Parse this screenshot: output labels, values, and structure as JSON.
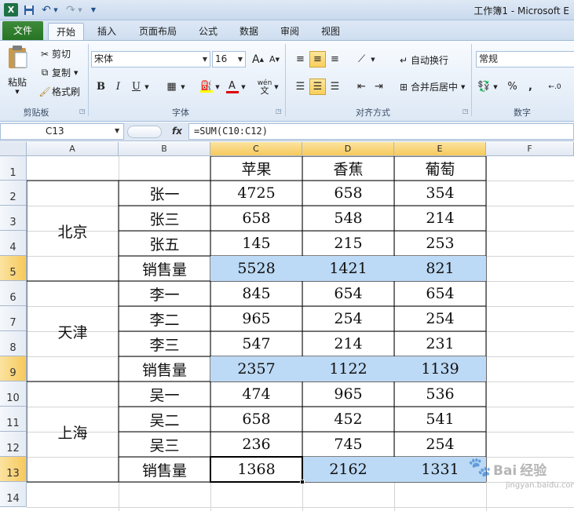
{
  "title_bar": {
    "title": "工作簿1 - Microsoft E"
  },
  "tabs": [
    {
      "label": "文件"
    },
    {
      "label": "开始"
    },
    {
      "label": "插入"
    },
    {
      "label": "页面布局"
    },
    {
      "label": "公式"
    },
    {
      "label": "数据"
    },
    {
      "label": "审阅"
    },
    {
      "label": "视图"
    }
  ],
  "ribbon": {
    "clipboard": {
      "paste": "粘贴",
      "cut": "剪切",
      "copy": "复制",
      "format_painter": "格式刷",
      "label": "剪贴板"
    },
    "font": {
      "name": "宋体",
      "size": "16",
      "label": "字体",
      "bold": "B",
      "italic": "I",
      "underline": "U",
      "grow": "A",
      "shrink": "A",
      "font_color": "A",
      "phonetic": "wén"
    },
    "alignment": {
      "wrap_text": "自动换行",
      "merge_center": "合并后居中",
      "label": "对齐方式"
    },
    "number": {
      "format": "常规",
      "percent": "%",
      "comma": ",",
      "label": "数字"
    }
  },
  "formula_bar": {
    "name_box": "C13",
    "fx": "fx",
    "formula": "=SUM(C10:C12)"
  },
  "sheet": {
    "columns": [
      "A",
      "B",
      "C",
      "D",
      "E",
      "F"
    ],
    "rows": [
      "1",
      "2",
      "3",
      "4",
      "5",
      "6",
      "7",
      "8",
      "9",
      "10",
      "11",
      "12",
      "13",
      "14"
    ],
    "headers": [
      "苹果",
      "香蕉",
      "葡萄"
    ],
    "groups": [
      {
        "city": "北京",
        "rows": [
          {
            "name": "张一",
            "values": [
              "4725",
              "658",
              "354"
            ]
          },
          {
            "name": "张三",
            "values": [
              "658",
              "548",
              "214"
            ]
          },
          {
            "name": "张五",
            "values": [
              "145",
              "215",
              "253"
            ]
          },
          {
            "name": "销售量",
            "values": [
              "5528",
              "1421",
              "821"
            ]
          }
        ]
      },
      {
        "city": "天津",
        "rows": [
          {
            "name": "李一",
            "values": [
              "845",
              "654",
              "654"
            ]
          },
          {
            "name": "李二",
            "values": [
              "965",
              "254",
              "254"
            ]
          },
          {
            "name": "李三",
            "values": [
              "547",
              "214",
              "231"
            ]
          },
          {
            "name": "销售量",
            "values": [
              "2357",
              "1122",
              "1139"
            ]
          }
        ]
      },
      {
        "city": "上海",
        "rows": [
          {
            "name": "吴一",
            "values": [
              "474",
              "965",
              "536"
            ]
          },
          {
            "name": "吴二",
            "values": [
              "658",
              "452",
              "541"
            ]
          },
          {
            "name": "吴三",
            "values": [
              "236",
              "745",
              "254"
            ]
          },
          {
            "name": "销售量",
            "values": [
              "1368",
              "2162",
              "1331"
            ]
          }
        ]
      }
    ]
  },
  "watermark": {
    "brand": "Bai",
    "brand2": "经验",
    "url": "jingyan.baidu.com"
  },
  "colors": {
    "highlight_fill": "#bcd9f5",
    "header_highlight": "#f6c95c",
    "file_tab": "#2f7d2c",
    "border": "#000000"
  }
}
